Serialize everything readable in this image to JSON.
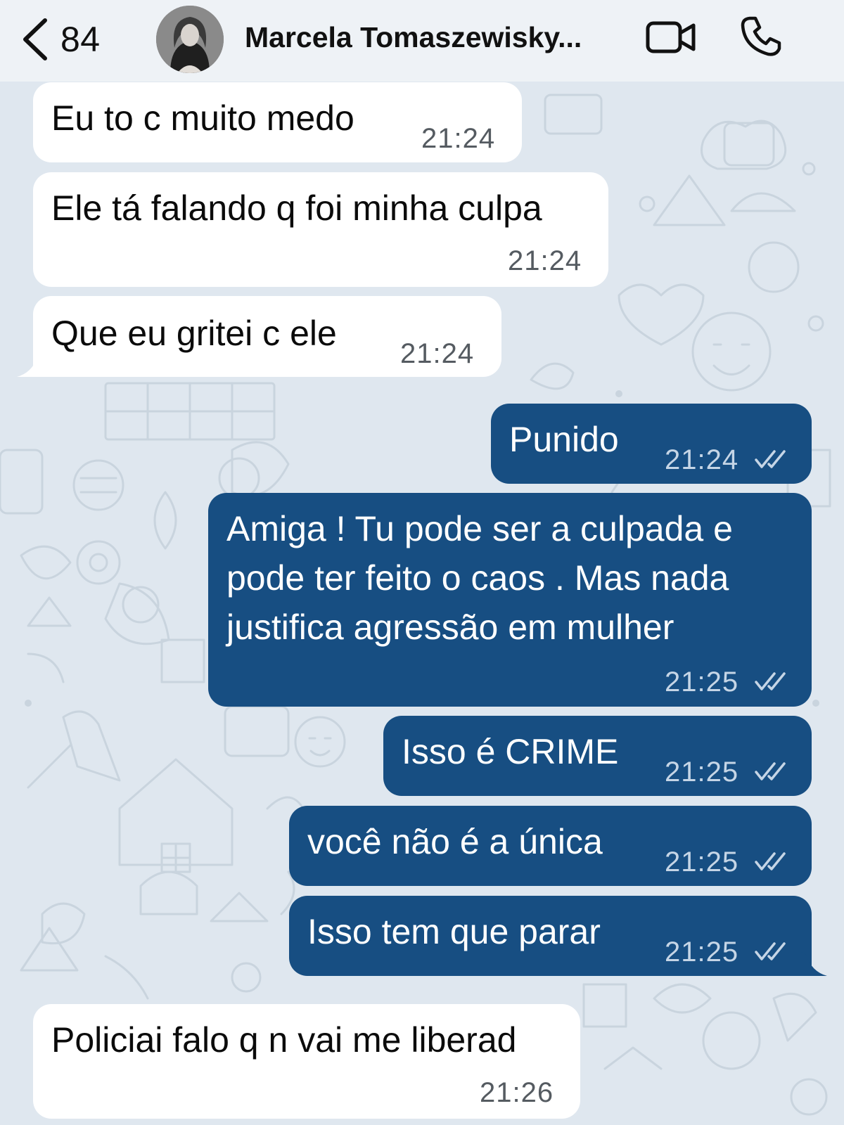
{
  "header": {
    "unread_count": "84",
    "contact_name": "Marcela Tomaszewisky..."
  },
  "colors": {
    "wallpaper": "#dfe7ef",
    "incoming_bubble": "#ffffff",
    "outgoing_bubble": "#174e82",
    "header_bg": "#eef2f6"
  },
  "icons": {
    "back": "chevron-left-icon",
    "video": "video-camera-icon",
    "phone": "phone-icon",
    "read_receipt": "double-check-icon"
  },
  "messages": [
    {
      "direction": "incoming",
      "text": "Eu to c muito medo",
      "time": "21:24"
    },
    {
      "direction": "incoming",
      "text": "Ele tá falando q foi minha culpa",
      "time": "21:24"
    },
    {
      "direction": "incoming",
      "text": "Que eu gritei c ele",
      "time": "21:24"
    },
    {
      "direction": "outgoing",
      "text": "Punido",
      "time": "21:24",
      "status": "read"
    },
    {
      "direction": "outgoing",
      "text": "Amiga ! Tu pode ser a culpada e pode ter feito o caos . Mas nada justifica agressão em mulher",
      "time": "21:25",
      "status": "read"
    },
    {
      "direction": "outgoing",
      "text": "Isso é CRIME",
      "time": "21:25",
      "status": "read"
    },
    {
      "direction": "outgoing",
      "text": "você não é a única",
      "time": "21:25",
      "status": "read"
    },
    {
      "direction": "outgoing",
      "text": "Isso tem que parar",
      "time": "21:25",
      "status": "read"
    },
    {
      "direction": "incoming",
      "text": "Policiai falo q n vai me liberad",
      "time": "21:26"
    }
  ]
}
